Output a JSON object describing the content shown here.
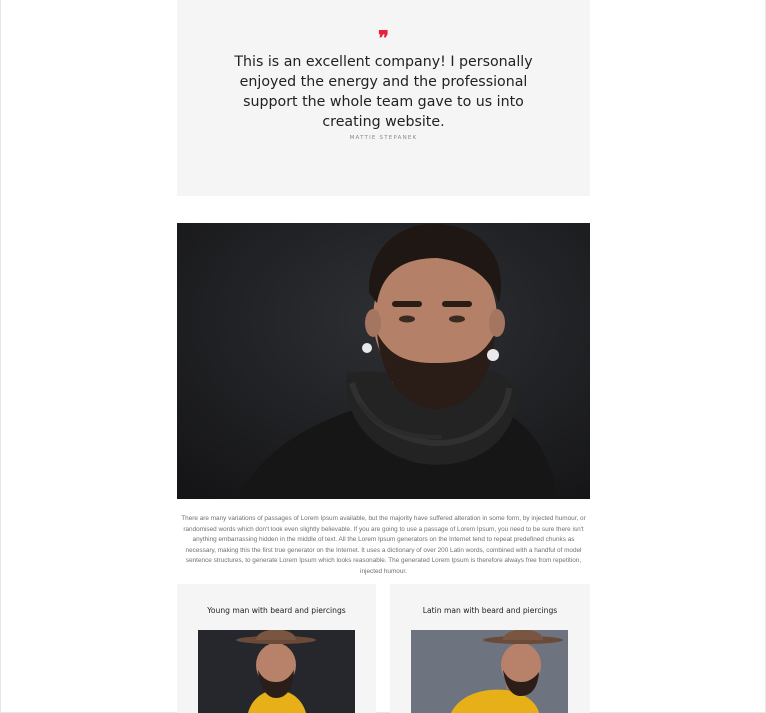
{
  "testimonial": {
    "quote_icon": "quote-icon",
    "quote": "This is an excellent company! I personally enjoyed the energy and the professional support the whole team gave to us into creating website.",
    "author": "MATTIE STEPANEK"
  },
  "hero": {
    "image": "portrait of bearded man with piercings in dark scarf"
  },
  "body": {
    "text": "There are many variations of passages of Lorem Ipsum available, but the majority have suffered alteration in some form, by injected humour, or randomised words which don't look even slightly believable. If you are going to use a passage of Lorem Ipsum, you need to be sure there isn't anything embarrassing hidden in the middle of text. All the Lorem Ipsum generators on the Internet tend to repeat predefined chunks as necessary, making this the first true generator on the Internet. It uses a dictionary of over 200 Latin words, combined with a handful of model sentence structures, to generate Lorem Ipsum which looks reasonable. The generated Lorem Ipsum is therefore always free from repetition, injected humour."
  },
  "cards": [
    {
      "title": "Young man with beard and piercings"
    },
    {
      "title": "Latin man with beard and piercings"
    }
  ],
  "colors": {
    "accent": "#e8203f",
    "card_bg": "#f5f5f5",
    "text": "#222222",
    "muted": "#707070"
  }
}
